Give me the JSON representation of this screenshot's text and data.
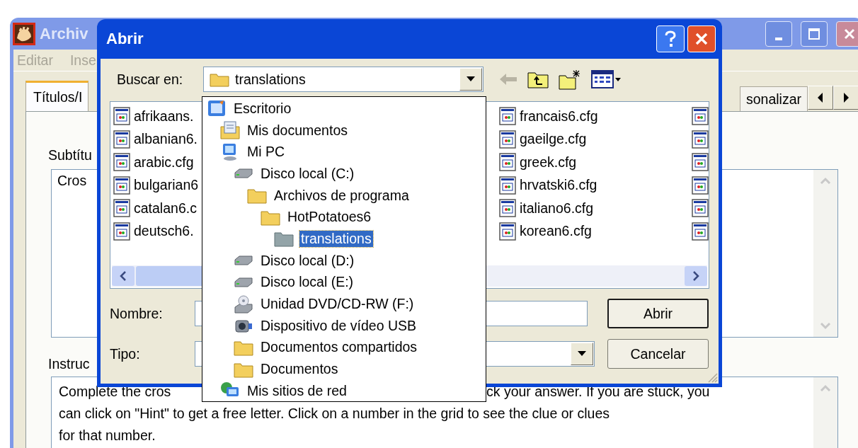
{
  "main_window": {
    "title": "Archiv",
    "menu": [
      {
        "label": "Editar"
      },
      {
        "label": "Inse"
      }
    ],
    "tabs": [
      {
        "label": "Títulos/I",
        "selected": true
      },
      {
        "label": "sonalizar",
        "selected": false
      }
    ],
    "subtitle": {
      "label": "Subtítu",
      "value": "Cros"
    },
    "instructions": {
      "label": "Instruc",
      "lines": [
        [
          "Complete the cros",
          "ck your answer. If you are stuck, you"
        ],
        [
          "can click on \"Hint\" to get a free letter. Click on a number in the grid to see the clue or clues"
        ],
        [
          "for that number."
        ]
      ]
    }
  },
  "dialog": {
    "title": "Abrir",
    "look_in": {
      "label": "Buscar en:",
      "value": "translations"
    },
    "folder_list": [
      {
        "label": "Escritorio",
        "kind": "desktop",
        "selected": false,
        "children": [
          {
            "label": "Mis documentos",
            "kind": "documents",
            "selected": false
          },
          {
            "label": "Mi PC",
            "kind": "computer",
            "selected": false,
            "children": [
              {
                "label": "Disco local (C:)",
                "kind": "drive",
                "selected": false,
                "children": [
                  {
                    "label": "Archivos de programa",
                    "kind": "folder",
                    "selected": false,
                    "children": [
                      {
                        "label": "HotPotatoes6",
                        "kind": "folder",
                        "selected": false,
                        "children": [
                          {
                            "label": "translations",
                            "kind": "folder",
                            "selected": true
                          }
                        ]
                      }
                    ]
                  }
                ]
              },
              {
                "label": "Disco local (D:)",
                "kind": "drive",
                "selected": false
              },
              {
                "label": "Disco local (E:)",
                "kind": "drive",
                "selected": false
              },
              {
                "label": "Unidad DVD/CD-RW (F:)",
                "kind": "dvd",
                "selected": false
              },
              {
                "label": "Dispositivo de vídeo USB",
                "kind": "camera",
                "selected": false
              },
              {
                "label": "Documentos compartidos",
                "kind": "folder",
                "selected": false
              },
              {
                "label": "Documentos",
                "kind": "folder",
                "selected": false
              }
            ]
          },
          {
            "label": "Mis sitios de red",
            "kind": "network",
            "selected": false
          }
        ]
      }
    ],
    "files": [
      {
        "name": "afrikaans."
      },
      {
        "name": "albanian6."
      },
      {
        "name": "arabic.cfg"
      },
      {
        "name": "bulgarian6"
      },
      {
        "name": "catalan6.c"
      },
      {
        "name": "deutsch6."
      },
      {
        "name": "francais6.cfg"
      },
      {
        "name": "gaeilge.cfg"
      },
      {
        "name": "greek.cfg"
      },
      {
        "name": "hrvatski6.cfg"
      },
      {
        "name": "italiano6.cfg"
      },
      {
        "name": "korean6.cfg"
      }
    ],
    "file_name": {
      "label": "Nombre:"
    },
    "file_type": {
      "label": "Tipo:"
    },
    "buttons": [
      {
        "label": "Abrir",
        "default": true
      },
      {
        "label": "Cancelar",
        "default": false
      }
    ]
  }
}
